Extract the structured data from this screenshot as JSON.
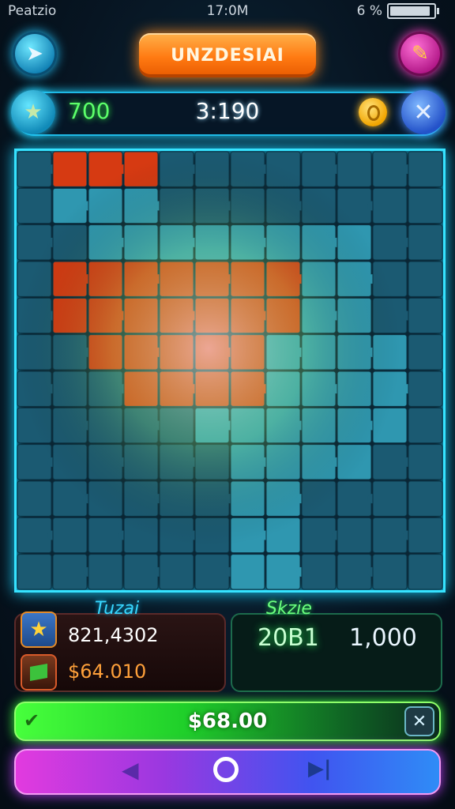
{
  "status_bar": {
    "carrier": "Peatzio",
    "time": "17:0M",
    "battery": "6 %",
    "battery_level": 0.92
  },
  "header": {
    "title": "UNZDESIAI",
    "back_icon": "arrow-left-icon",
    "tool_icon": "paintbrush-icon"
  },
  "scorebar": {
    "left_value": "700",
    "center_value": "3:190",
    "star_icon": "star-icon",
    "coin_icon": "coin-icon",
    "close_icon": "close-icon"
  },
  "board": {
    "cols": 12,
    "rows": 12,
    "cells": [
      "DRRRDDDDDDDD",
      "DTTTDDDDDDDD",
      "DDTTTTTTTTDD",
      "DRRRRRRRTTDD",
      "DRRRRRRRTTDD",
      "DDRRRRRTTTTD",
      "DDDRRRRTTTTD",
      "DDDDDTTTTTTD",
      "DDDDDDTTTTDD",
      "DDDDDDTTDDDD",
      "DDDDDDTTDDDD",
      "DDDDDDTTDDDD"
    ],
    "colors": {
      "dark": "#1b5a72",
      "teal": "#2f97b0",
      "red": "#d63a12"
    }
  },
  "stats": {
    "left_title": "Tuzai",
    "right_title": "Skzie",
    "value_1": "821,4302",
    "value_2": "$64.010",
    "value_3": "20B1",
    "value_4": "1,000",
    "star_icon": "star-icon",
    "card_icon": "card-icon"
  },
  "action_bar": {
    "label": "$68.00",
    "check_icon": "checkmark-icon",
    "close_icon": "close-icon"
  },
  "nav_bar": {
    "prev_icon": "triangle-left-icon",
    "home_icon": "circle-icon",
    "next_icon": "skip-forward-icon"
  }
}
